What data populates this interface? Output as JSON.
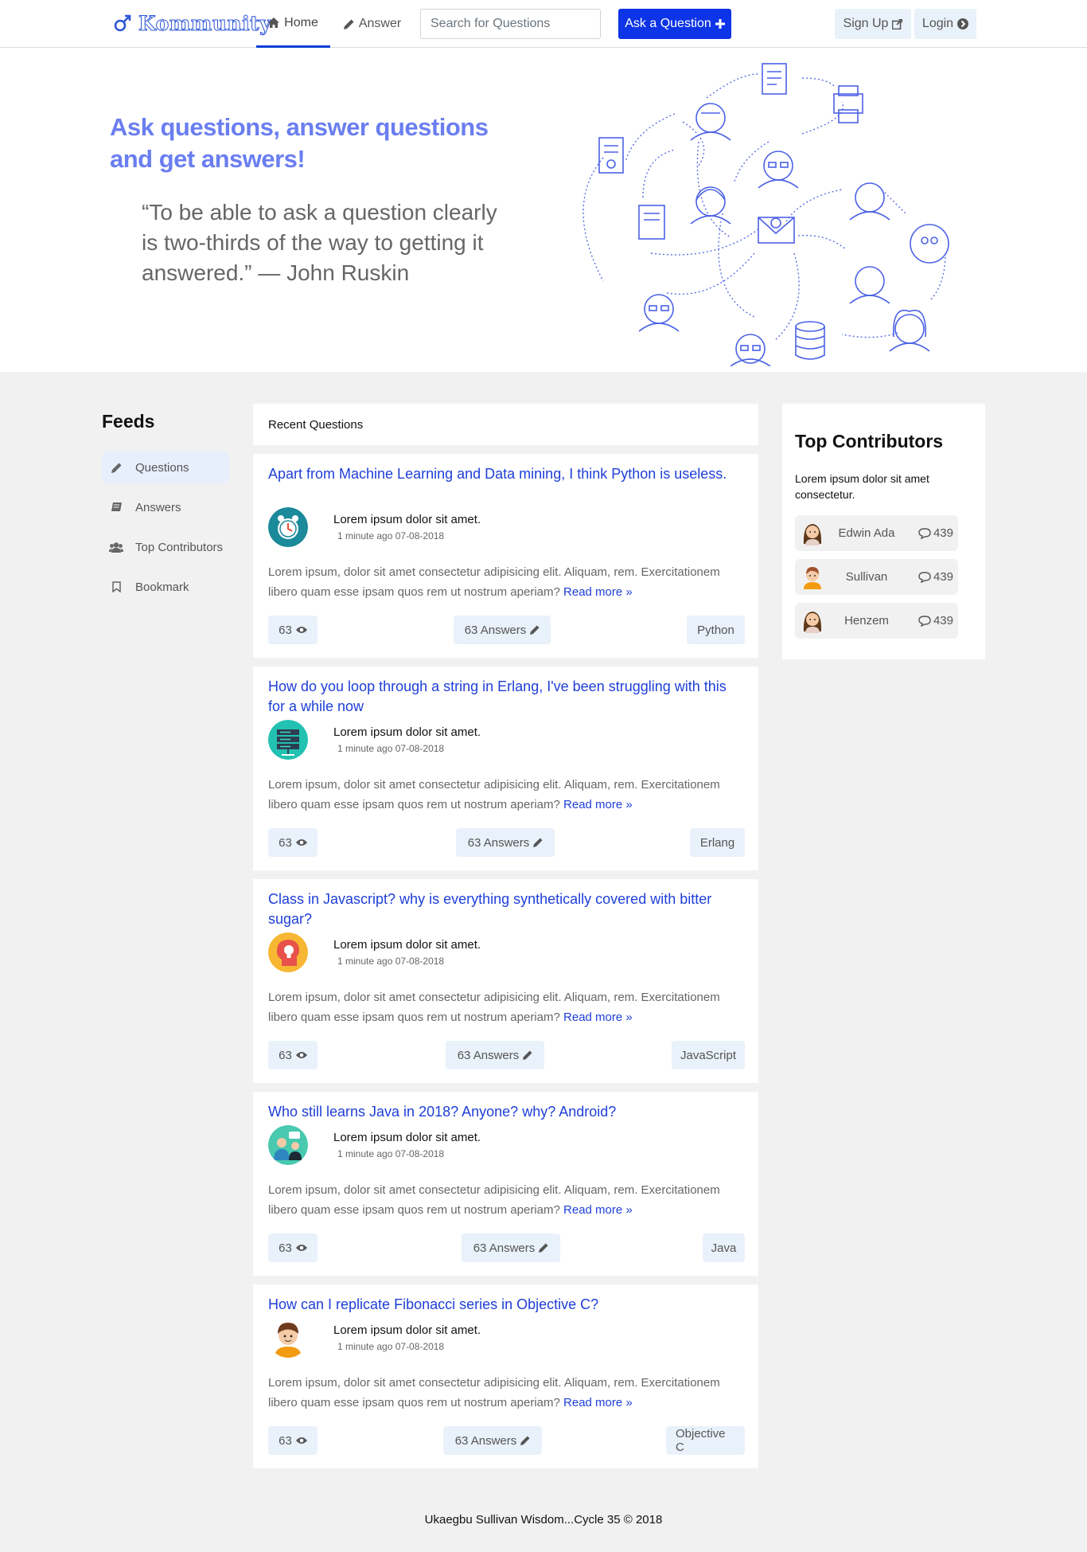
{
  "nav": {
    "brand": "Kommunity",
    "home_label": "Home",
    "answer_label": "Answer",
    "search_placeholder": "Search for Questions",
    "ask_label": "Ask a Question",
    "signup_label": "Sign Up",
    "login_label": "Login"
  },
  "hero": {
    "title": "Ask questions, answer questions and get answers!",
    "quote": "“To be able to ask a question clearly is two-thirds of the way to getting it answered.” — John Ruskin"
  },
  "feeds": {
    "title": "Feeds",
    "items": [
      {
        "label": "Questions",
        "icon": "pencil-icon"
      },
      {
        "label": "Answers",
        "icon": "book-icon"
      },
      {
        "label": "Top Contributors",
        "icon": "users-icon"
      },
      {
        "label": "Bookmark",
        "icon": "bookmark-icon"
      }
    ]
  },
  "recent": {
    "header": "Recent Questions",
    "read_more": "Read more",
    "questions": [
      {
        "title": "Apart from Machine Learning and Data mining, I think Python is useless.",
        "author": "Lorem ipsum dolor sit amet.",
        "time": "1 minute ago 07-08-2018",
        "body": "Lorem ipsum, dolor sit amet consectetur adipisicing elit. Aliquam, rem. Exercitationem libero quam esse ipsam quos rem ut nostrum aperiam?",
        "views": "63",
        "answers": "63 Answers",
        "tag": "Python",
        "avatar": "clock-icon"
      },
      {
        "title": "How do you loop through a string in Erlang, I've been struggling with this for a while now",
        "author": "Lorem ipsum dolor sit amet.",
        "time": "1 minute ago 07-08-2018",
        "body": "Lorem ipsum, dolor sit amet consectetur adipisicing elit. Aliquam, rem. Exercitationem libero quam esse ipsam quos rem ut nostrum aperiam?",
        "views": "63",
        "answers": "63 Answers",
        "tag": "Erlang",
        "avatar": "server-icon"
      },
      {
        "title": "Class in Javascript? why is everything synthetically covered with bitter sugar?",
        "author": "Lorem ipsum dolor sit amet.",
        "time": "1 minute ago 07-08-2018",
        "body": "Lorem ipsum, dolor sit amet consectetur adipisicing elit. Aliquam, rem. Exercitationem libero quam esse ipsam quos rem ut nostrum aperiam?",
        "views": "63",
        "answers": "63 Answers",
        "tag": "JavaScript",
        "avatar": "lightbulb-head-icon"
      },
      {
        "title": "Who still learns Java in 2018? Anyone? why? Android?",
        "author": "Lorem ipsum dolor sit amet.",
        "time": "1 minute ago 07-08-2018",
        "body": "Lorem ipsum, dolor sit amet consectetur adipisicing elit. Aliquam, rem. Exercitationem libero quam esse ipsam quos rem ut nostrum aperiam?",
        "views": "63",
        "answers": "63 Answers",
        "tag": "Java",
        "avatar": "people-chat-icon"
      },
      {
        "title": "How can I replicate Fibonacci series in Objective C?",
        "author": "Lorem ipsum dolor sit amet.",
        "time": "1 minute ago 07-08-2018",
        "body": "Lorem ipsum, dolor sit amet consectetur adipisicing elit. Aliquam, rem. Exercitationem libero quam esse ipsam quos rem ut nostrum aperiam?",
        "views": "63",
        "answers": "63 Answers",
        "tag": "Objective C",
        "avatar": "boy-avatar-icon"
      }
    ]
  },
  "contributors": {
    "title": "Top Contributors",
    "description": "Lorem ipsum dolor sit amet consectetur.",
    "people": [
      {
        "name": "Edwin Ada",
        "count": "439",
        "avatar": "woman-avatar-icon"
      },
      {
        "name": "Sullivan",
        "count": "439",
        "avatar": "man-avatar-icon"
      },
      {
        "name": "Henzem",
        "count": "439",
        "avatar": "woman-avatar-icon"
      }
    ]
  },
  "footer": "Ukaegbu Sullivan Wisdom...Cycle 35 © 2018",
  "colors": {
    "accent": "#0d34e6",
    "link": "#1e3fd8",
    "hero_title": "#6a7ef0",
    "pill_bg": "#e9f1fa"
  }
}
